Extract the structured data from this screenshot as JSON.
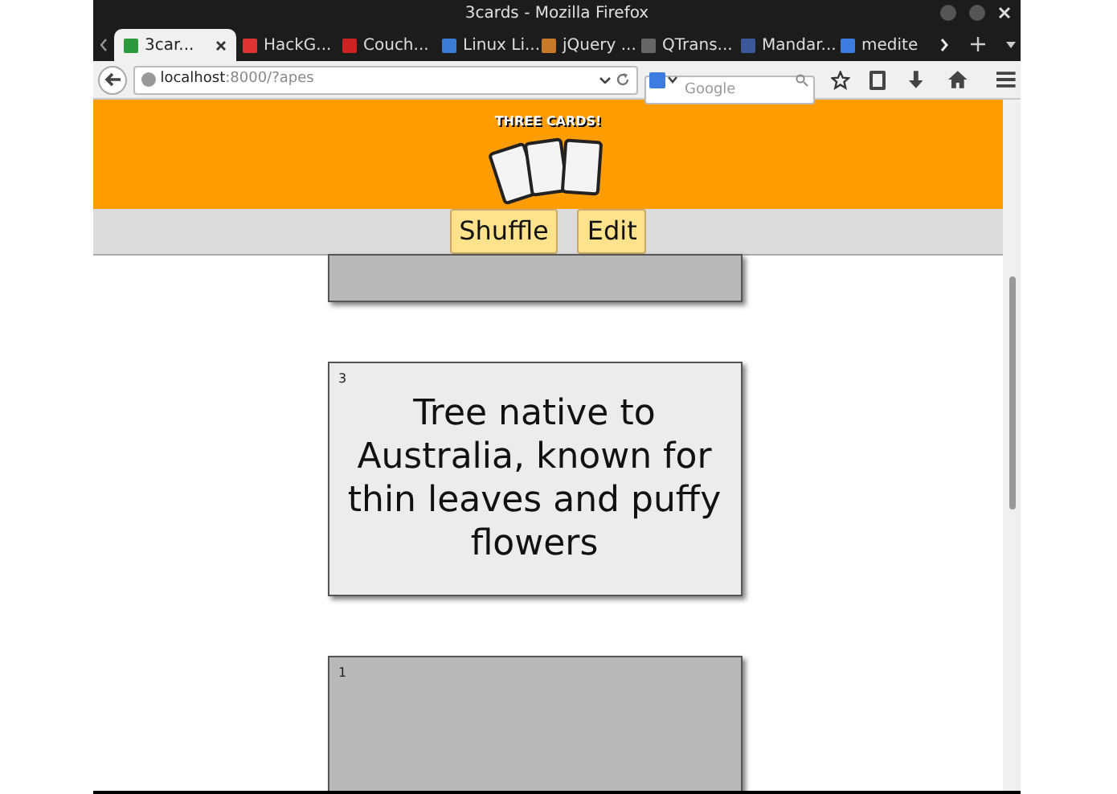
{
  "window": {
    "title": "3cards - Mozilla Firefox"
  },
  "tabs": [
    {
      "label": "3car...",
      "selected": true
    },
    {
      "label": "HackG...",
      "selected": false
    },
    {
      "label": "Couch...",
      "selected": false
    },
    {
      "label": "Linux Li...",
      "selected": false
    },
    {
      "label": "jQuery ...",
      "selected": false
    },
    {
      "label": "QTrans...",
      "selected": false
    },
    {
      "label": "Mandar...",
      "selected": false
    },
    {
      "label": "medite",
      "selected": false
    }
  ],
  "address_bar": {
    "host": "localhost",
    "rest": ":8000/?apes"
  },
  "search": {
    "placeholder": "Google"
  },
  "page": {
    "logo_text": "THREE CARDS!",
    "buttons": [
      "Shuffle",
      "Edit"
    ],
    "cards": [
      {
        "active": false
      },
      {
        "number": "3",
        "text": "Tree native to Australia, known for thin leaves and puffy flowers",
        "active": true
      },
      {
        "number": "1",
        "active": false
      }
    ]
  }
}
